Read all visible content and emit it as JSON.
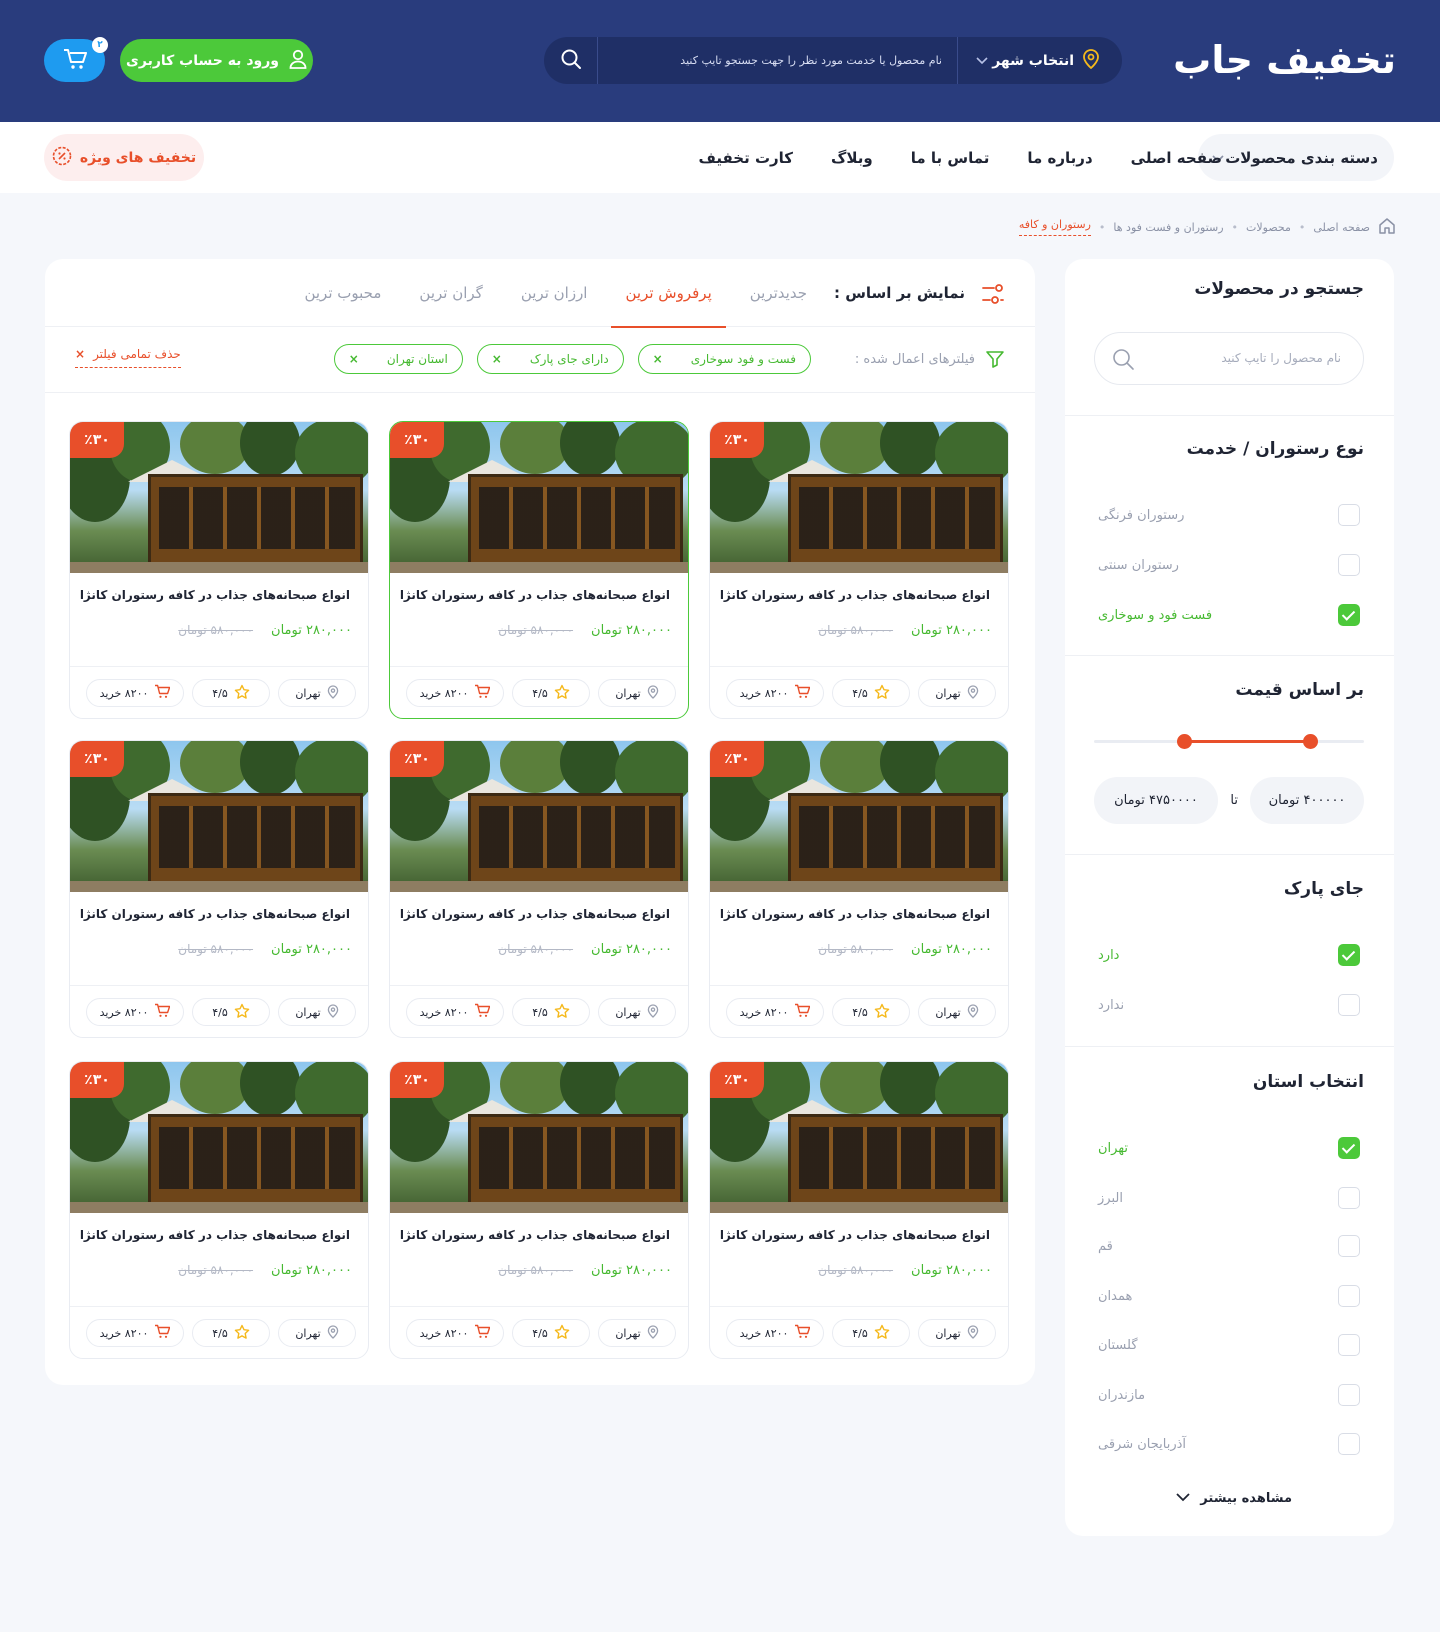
{
  "header": {
    "logo": "تخفیف جاب",
    "city_label": "انتخاب شهر",
    "search_placeholder": "نام محصول یا خدمت مورد نظر را جهت جستجو تایپ کنید",
    "login_label": "ورود به حساب کاربری",
    "cart_count": "۲"
  },
  "nav": {
    "categories_label": "دسته بندی محصولات",
    "links": [
      "صفحه اصلی",
      "درباره ما",
      "تماس با ما",
      "وبلاگ",
      "کارت تخفیف"
    ],
    "special_label": "تخفیف های ویژه"
  },
  "breadcrumb": [
    "صفحه اصلی",
    "محصولات",
    "رستوران و فست فود ها",
    "رستوران و کافه"
  ],
  "sidebar": {
    "search_title": "جستجو در محصولات",
    "search_placeholder": "نام محصول را تایپ کنید",
    "type_title": "نوع رستوران / خدمت",
    "type_options": [
      {
        "label": "رستوران فرنگی",
        "checked": false
      },
      {
        "label": "رستوران سنتی",
        "checked": false
      },
      {
        "label": "فست فود و سوخاری",
        "checked": true
      }
    ],
    "price_title": "بر اساس قیمت",
    "price_min": "۴۰۰۰۰۰ تومان",
    "price_to": "تا",
    "price_max": "۴۷۵۰۰۰۰ تومان",
    "parking_title": "جای پارک",
    "parking_options": [
      {
        "label": "دارد",
        "checked": true
      },
      {
        "label": "ندارد",
        "checked": false
      }
    ],
    "province_title": "انتخاب استان",
    "province_options": [
      {
        "label": "تهران",
        "checked": true
      },
      {
        "label": "البرز",
        "checked": false
      },
      {
        "label": "قم",
        "checked": false
      },
      {
        "label": "همدان",
        "checked": false
      },
      {
        "label": "گلستان",
        "checked": false
      },
      {
        "label": "مازندران",
        "checked": false
      },
      {
        "label": "آذربایجان شرقی",
        "checked": false
      }
    ],
    "show_more": "مشاهده بیشتر"
  },
  "sort": {
    "label": "نمایش بر اساس :",
    "tabs": [
      "جدیدترین",
      "پرفروش ترین",
      "ارزان ترین",
      "گران ترین",
      "محبوب ترین"
    ],
    "active_index": 1
  },
  "filters": {
    "label": "فیلترهای اعمال شده :",
    "chips": [
      "فست و فود سوخاری",
      "دارای جای پارک",
      "استان تهران"
    ],
    "clear_label": "حذف تمامی فیلتر"
  },
  "colors": {
    "header_bg": "#293c7d",
    "accent_orange": "#e84f2a",
    "accent_green": "#4cc93a",
    "cart_blue": "#1e9bf0"
  },
  "product": {
    "discount": "٪۳۰",
    "title": "انواع صبحانه‌های جذاب در کافه رستوران کانژا",
    "price_new": "۲۸۰,۰۰۰ تومان",
    "price_old": "۵۸۰,۰۰۰ تومان",
    "city": "تهران",
    "rating": "۴/۵",
    "buy_label": "۸۲۰۰ خرید"
  },
  "products": [
    {
      "highlighted": false
    },
    {
      "highlighted": true
    },
    {
      "highlighted": false
    },
    {
      "highlighted": false
    },
    {
      "highlighted": false
    },
    {
      "highlighted": false
    },
    {
      "highlighted": false
    },
    {
      "highlighted": false
    },
    {
      "highlighted": false
    }
  ]
}
